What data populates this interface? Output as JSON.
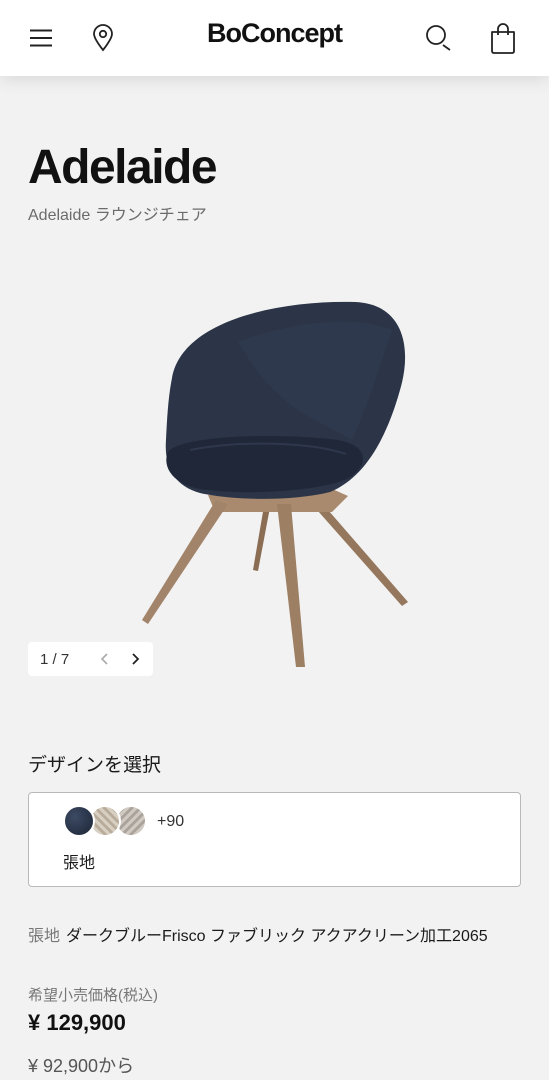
{
  "header": {
    "logo": "BoConcept",
    "icons": [
      "menu-icon",
      "location-pin-icon",
      "search-icon",
      "shopping-bag-icon"
    ]
  },
  "product": {
    "title": "Adelaide",
    "subtitle": "Adelaide ラウンジチェア"
  },
  "gallery": {
    "counter": "1 / 7",
    "prev_icon": "chevron-left-icon",
    "next_icon": "chevron-right-icon"
  },
  "design": {
    "heading": "デザインを選択",
    "more_count": "+90",
    "caption": "張地",
    "swatch_colors": [
      "#2a3447",
      "#c9bcab",
      "#bdb6ae"
    ]
  },
  "fabric": {
    "label": "張地",
    "value": "ダークブルーFrisco ファブリック アクアクリーン加工2065"
  },
  "pricing": {
    "label": "希望小売価格(税込)",
    "price": "¥ 129,900",
    "from": "¥ 92,900から"
  },
  "colors": {
    "background": "#f2f2f2",
    "header_bg": "#ffffff",
    "upholstery": "#252f40",
    "wood": "#9c7d61"
  }
}
